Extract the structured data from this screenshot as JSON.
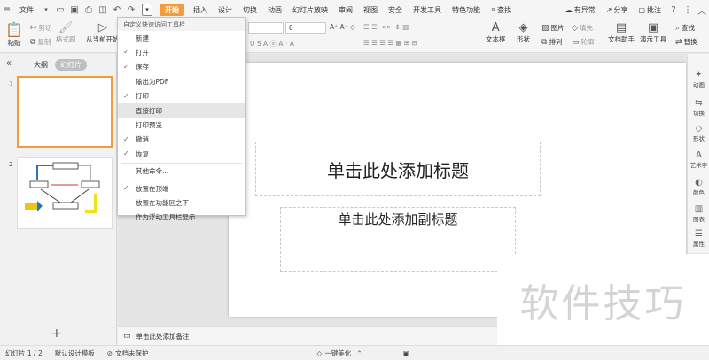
{
  "menubar": {
    "file": "文件",
    "tabs": [
      "开始",
      "插入",
      "设计",
      "切换",
      "动画",
      "幻灯片放映",
      "审阅",
      "视图",
      "安全",
      "开发工具",
      "特色功能"
    ],
    "search": "查找",
    "right": {
      "changes": "有异常",
      "share": "分享",
      "comment": "批注"
    }
  },
  "ribbon": {
    "paste": "粘贴",
    "cut": "剪切",
    "copy": "复制",
    "format_painter": "格式刷",
    "from_current": "从当前开始",
    "font_size": "0",
    "textbox": "文本框",
    "shape": "形状",
    "picture": "图片",
    "arrange": "排列",
    "fill": "填充",
    "outline": "轮廓",
    "doc_assistant": "文档助手",
    "present_tool": "演示工具",
    "find": "查找",
    "replace": "替换"
  },
  "quick_menu": {
    "header": "自定义快速访问工具栏",
    "items": [
      {
        "label": "新建",
        "checked": false
      },
      {
        "label": "打开",
        "checked": true
      },
      {
        "label": "保存",
        "checked": true
      },
      {
        "label": "输出为PDF",
        "checked": false
      },
      {
        "label": "打印",
        "checked": true
      },
      {
        "label": "直接打印",
        "checked": false
      },
      {
        "label": "打印预览",
        "checked": false
      },
      {
        "label": "撤消",
        "checked": true
      },
      {
        "label": "恢复",
        "checked": true
      },
      {
        "label": "其他命令...",
        "checked": false
      },
      {
        "label": "放置在顶端",
        "checked": true
      },
      {
        "label": "放置在功能区之下",
        "checked": false
      },
      {
        "label": "作为浮动工具栏显示",
        "checked": false
      }
    ]
  },
  "left_panel": {
    "tab_outline": "大纲",
    "tab_slides": "幻灯片",
    "slide1_num": "1",
    "slide2_num": "2",
    "add": "+"
  },
  "slide": {
    "title": "单击此处添加标题",
    "subtitle": "单击此处添加副标题"
  },
  "notes": "单击此处添加备注",
  "right_sidebar": [
    "动画",
    "切换",
    "形状",
    "艺术字",
    "颜色",
    "图表",
    "属性"
  ],
  "status": {
    "slide": "幻灯片 1 / 2",
    "template": "默认设计模板",
    "protect": "文档未保护",
    "beautify": "一键美化"
  },
  "watermark": "软件技巧",
  "colors": {
    "accent": "#f39c3b",
    "menu_highlight": "#e6e6e6"
  }
}
